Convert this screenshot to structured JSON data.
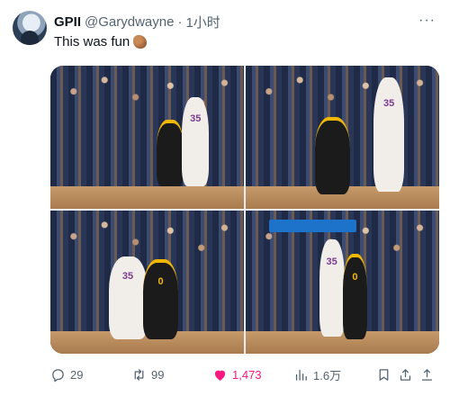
{
  "author": {
    "name": "GPII",
    "handle": "@Garydwayne",
    "separator": "·",
    "time": "1小时"
  },
  "more_glyph": "···",
  "tweet_text": "This was fun",
  "emoji_name": "brown-heart-emoji",
  "photos": [
    {
      "jersey": "35"
    },
    {
      "jersey": "35"
    },
    {
      "jersey": "35",
      "jersey2": "0"
    },
    {
      "jersey": "35",
      "jersey2": "0"
    }
  ],
  "actions": {
    "replies": "29",
    "retweets": "99",
    "likes": "1,473",
    "views": "1.6万"
  },
  "colors": {
    "like": "#f91880",
    "muted": "#536471",
    "text": "#0f1419"
  }
}
